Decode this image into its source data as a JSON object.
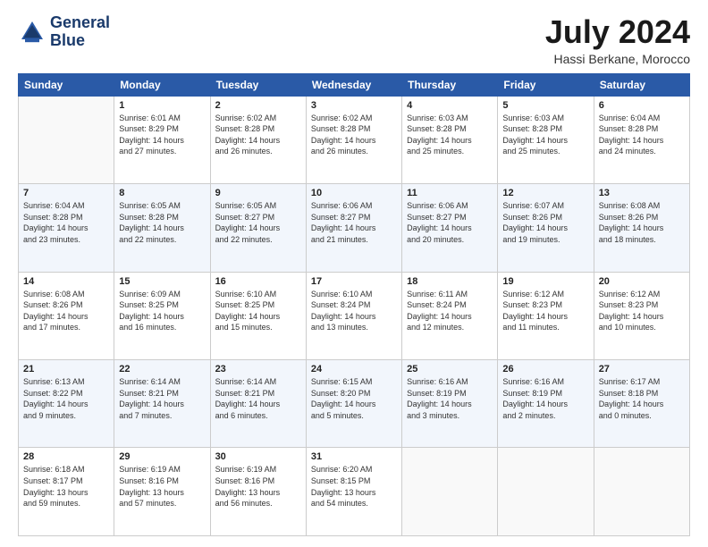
{
  "header": {
    "logo_line1": "General",
    "logo_line2": "Blue",
    "month": "July 2024",
    "location": "Hassi Berkane, Morocco"
  },
  "weekdays": [
    "Sunday",
    "Monday",
    "Tuesday",
    "Wednesday",
    "Thursday",
    "Friday",
    "Saturday"
  ],
  "weeks": [
    [
      {
        "day": "",
        "info": ""
      },
      {
        "day": "1",
        "info": "Sunrise: 6:01 AM\nSunset: 8:29 PM\nDaylight: 14 hours\nand 27 minutes."
      },
      {
        "day": "2",
        "info": "Sunrise: 6:02 AM\nSunset: 8:28 PM\nDaylight: 14 hours\nand 26 minutes."
      },
      {
        "day": "3",
        "info": "Sunrise: 6:02 AM\nSunset: 8:28 PM\nDaylight: 14 hours\nand 26 minutes."
      },
      {
        "day": "4",
        "info": "Sunrise: 6:03 AM\nSunset: 8:28 PM\nDaylight: 14 hours\nand 25 minutes."
      },
      {
        "day": "5",
        "info": "Sunrise: 6:03 AM\nSunset: 8:28 PM\nDaylight: 14 hours\nand 25 minutes."
      },
      {
        "day": "6",
        "info": "Sunrise: 6:04 AM\nSunset: 8:28 PM\nDaylight: 14 hours\nand 24 minutes."
      }
    ],
    [
      {
        "day": "7",
        "info": "Sunrise: 6:04 AM\nSunset: 8:28 PM\nDaylight: 14 hours\nand 23 minutes."
      },
      {
        "day": "8",
        "info": "Sunrise: 6:05 AM\nSunset: 8:28 PM\nDaylight: 14 hours\nand 22 minutes."
      },
      {
        "day": "9",
        "info": "Sunrise: 6:05 AM\nSunset: 8:27 PM\nDaylight: 14 hours\nand 22 minutes."
      },
      {
        "day": "10",
        "info": "Sunrise: 6:06 AM\nSunset: 8:27 PM\nDaylight: 14 hours\nand 21 minutes."
      },
      {
        "day": "11",
        "info": "Sunrise: 6:06 AM\nSunset: 8:27 PM\nDaylight: 14 hours\nand 20 minutes."
      },
      {
        "day": "12",
        "info": "Sunrise: 6:07 AM\nSunset: 8:26 PM\nDaylight: 14 hours\nand 19 minutes."
      },
      {
        "day": "13",
        "info": "Sunrise: 6:08 AM\nSunset: 8:26 PM\nDaylight: 14 hours\nand 18 minutes."
      }
    ],
    [
      {
        "day": "14",
        "info": "Sunrise: 6:08 AM\nSunset: 8:26 PM\nDaylight: 14 hours\nand 17 minutes."
      },
      {
        "day": "15",
        "info": "Sunrise: 6:09 AM\nSunset: 8:25 PM\nDaylight: 14 hours\nand 16 minutes."
      },
      {
        "day": "16",
        "info": "Sunrise: 6:10 AM\nSunset: 8:25 PM\nDaylight: 14 hours\nand 15 minutes."
      },
      {
        "day": "17",
        "info": "Sunrise: 6:10 AM\nSunset: 8:24 PM\nDaylight: 14 hours\nand 13 minutes."
      },
      {
        "day": "18",
        "info": "Sunrise: 6:11 AM\nSunset: 8:24 PM\nDaylight: 14 hours\nand 12 minutes."
      },
      {
        "day": "19",
        "info": "Sunrise: 6:12 AM\nSunset: 8:23 PM\nDaylight: 14 hours\nand 11 minutes."
      },
      {
        "day": "20",
        "info": "Sunrise: 6:12 AM\nSunset: 8:23 PM\nDaylight: 14 hours\nand 10 minutes."
      }
    ],
    [
      {
        "day": "21",
        "info": "Sunrise: 6:13 AM\nSunset: 8:22 PM\nDaylight: 14 hours\nand 9 minutes."
      },
      {
        "day": "22",
        "info": "Sunrise: 6:14 AM\nSunset: 8:21 PM\nDaylight: 14 hours\nand 7 minutes."
      },
      {
        "day": "23",
        "info": "Sunrise: 6:14 AM\nSunset: 8:21 PM\nDaylight: 14 hours\nand 6 minutes."
      },
      {
        "day": "24",
        "info": "Sunrise: 6:15 AM\nSunset: 8:20 PM\nDaylight: 14 hours\nand 5 minutes."
      },
      {
        "day": "25",
        "info": "Sunrise: 6:16 AM\nSunset: 8:19 PM\nDaylight: 14 hours\nand 3 minutes."
      },
      {
        "day": "26",
        "info": "Sunrise: 6:16 AM\nSunset: 8:19 PM\nDaylight: 14 hours\nand 2 minutes."
      },
      {
        "day": "27",
        "info": "Sunrise: 6:17 AM\nSunset: 8:18 PM\nDaylight: 14 hours\nand 0 minutes."
      }
    ],
    [
      {
        "day": "28",
        "info": "Sunrise: 6:18 AM\nSunset: 8:17 PM\nDaylight: 13 hours\nand 59 minutes."
      },
      {
        "day": "29",
        "info": "Sunrise: 6:19 AM\nSunset: 8:16 PM\nDaylight: 13 hours\nand 57 minutes."
      },
      {
        "day": "30",
        "info": "Sunrise: 6:19 AM\nSunset: 8:16 PM\nDaylight: 13 hours\nand 56 minutes."
      },
      {
        "day": "31",
        "info": "Sunrise: 6:20 AM\nSunset: 8:15 PM\nDaylight: 13 hours\nand 54 minutes."
      },
      {
        "day": "",
        "info": ""
      },
      {
        "day": "",
        "info": ""
      },
      {
        "day": "",
        "info": ""
      }
    ]
  ]
}
